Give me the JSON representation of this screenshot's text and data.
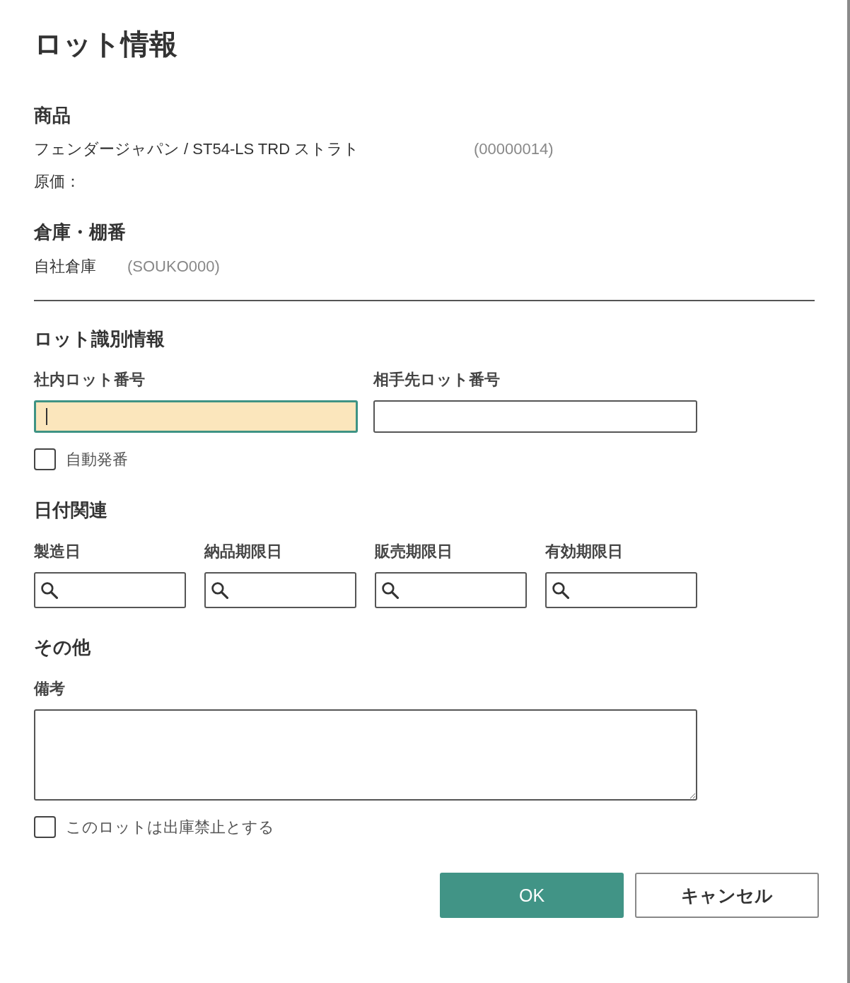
{
  "dialog": {
    "title": "ロット情報"
  },
  "product": {
    "heading": "商品",
    "name": "フェンダージャパン / ST54-LS TRD ストラト",
    "code": "(00000014)",
    "cost_label": "原価："
  },
  "location": {
    "heading": "倉庫・棚番",
    "name": "自社倉庫",
    "code": "(SOUKO000)"
  },
  "lot_identification": {
    "heading": "ロット識別情報",
    "fields": [
      {
        "label": "社内ロット番号",
        "focused": true
      },
      {
        "label": "相手先ロット番号",
        "focused": false
      }
    ],
    "auto_number": {
      "label": "自動発番",
      "checked": false
    }
  },
  "dates": {
    "heading": "日付関連",
    "fields": [
      {
        "label": "製造日"
      },
      {
        "label": "納品期限日"
      },
      {
        "label": "販売期限日"
      },
      {
        "label": "有効期限日"
      }
    ]
  },
  "other": {
    "heading": "その他",
    "remarks_label": "備考",
    "ship_block": {
      "label": "このロットは出庫禁止とする",
      "checked": false
    }
  },
  "buttons": [
    {
      "label": "OK",
      "kind": "primary"
    },
    {
      "label": "キャンセル",
      "kind": "secondary"
    }
  ]
}
